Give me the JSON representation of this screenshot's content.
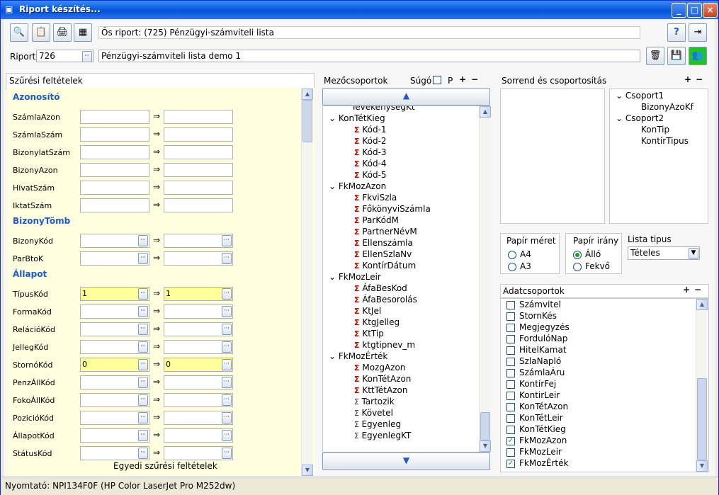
{
  "window": {
    "title": "Riport készítés...",
    "min": "_",
    "max": "□",
    "close": "×"
  },
  "toolbar": {
    "parent_label": "Ős riport:",
    "parent_value": "(725)  Pénzügyi-számviteli lista",
    "report_label": "Riport",
    "report_id": "726",
    "report_name": "Pénzügyi-számviteli lista demo 1"
  },
  "filter": {
    "title": "Szűrési feltételek",
    "footer": "Egyedi szűrési feltételek",
    "sections": [
      {
        "name": "Azonosító"
      },
      {
        "name": "BizonyTömb"
      },
      {
        "name": "Állapot"
      }
    ],
    "rows": [
      {
        "label": "SzámlaAzon",
        "from": "",
        "to": ""
      },
      {
        "label": "SzámlaSzám",
        "from": "",
        "to": ""
      },
      {
        "label": "BizonylatSzám",
        "from": "",
        "to": ""
      },
      {
        "label": "BizonyAzon",
        "from": "",
        "to": ""
      },
      {
        "label": "HivatSzám",
        "from": "",
        "to": ""
      },
      {
        "label": "IktatSzám",
        "from": "",
        "to": ""
      },
      {
        "label": "BizonyKód",
        "from": "",
        "to": ""
      },
      {
        "label": "ParBtoK",
        "from": "",
        "to": ""
      },
      {
        "label": "TípusKód",
        "from": "1",
        "to": "1"
      },
      {
        "label": "FormaKód",
        "from": "",
        "to": ""
      },
      {
        "label": "RelációKód",
        "from": "",
        "to": ""
      },
      {
        "label": "JellegKód",
        "from": "",
        "to": ""
      },
      {
        "label": "StornóKód",
        "from": "0",
        "to": "0"
      },
      {
        "label": "PenzÁllKód",
        "from": "",
        "to": ""
      },
      {
        "label": "FokoÁllKód",
        "from": "",
        "to": ""
      },
      {
        "label": "PozicióKód",
        "from": "",
        "to": ""
      },
      {
        "label": "ÁllapotKód",
        "from": "",
        "to": ""
      },
      {
        "label": "StátusKód",
        "from": "",
        "to": ""
      }
    ],
    "arrow": "⇒"
  },
  "fields": {
    "title": "Mezőcsoportok",
    "help": "Súgó",
    "p": "P",
    "plus": "+",
    "minus": "−",
    "partial": "TevékenységKt",
    "groups": [
      {
        "name": "KonTétKieg",
        "items": [
          "Kód-1",
          "Kód-2",
          "Kód-3",
          "Kód-4",
          "Kód-5"
        ]
      },
      {
        "name": "FkMozAzon",
        "items": [
          "FkviSzla",
          "FőkönyviSzámla",
          "ParKódM",
          "PartnerNévM",
          "Ellenszámla",
          "EllenSzlaNv",
          "KontírDátum"
        ]
      },
      {
        "name": "FkMozLeir",
        "items": [
          "ÁfaBesKod",
          "ÁfaBesorolás",
          "KtJel",
          "KtgJelleg",
          "KtTip",
          "ktgtipnev_m"
        ]
      },
      {
        "name": "FkMozÉrték",
        "items": [
          "MozgAzon",
          "KonTétAzon",
          "KttTétAzon",
          "Tartozik",
          "Követel",
          "Egyenleg",
          "EgyenlegKT"
        ]
      }
    ]
  },
  "sort": {
    "title": "Sorrend és csoportosítás",
    "groups": [
      {
        "name": "Csoport1",
        "items": [
          "BizonyAzoKf"
        ]
      },
      {
        "name": "Csoport2",
        "items": [
          "KonTip",
          "KontírTipus"
        ]
      }
    ]
  },
  "paper": {
    "size_title": "Papír méret",
    "sizes": [
      "A4",
      "A3"
    ],
    "dir_title": "Papír irány",
    "dirs": [
      "Álló",
      "Fekvő"
    ],
    "list_title": "Lista tipus",
    "list_value": "Tételes"
  },
  "datagroups": {
    "title": "Adatcsoportok",
    "items": [
      {
        "name": "Számvitel",
        "checked": false
      },
      {
        "name": "StornKés",
        "checked": false
      },
      {
        "name": "Megjegyzés",
        "checked": false
      },
      {
        "name": "FordulóNap",
        "checked": false
      },
      {
        "name": "HitelKamat",
        "checked": false
      },
      {
        "name": "SzlaNapló",
        "checked": false
      },
      {
        "name": "SzámlaÁru",
        "checked": false
      },
      {
        "name": "KontírFej",
        "checked": false
      },
      {
        "name": "KontirLeir",
        "checked": false
      },
      {
        "name": "KonTétAzon",
        "checked": false
      },
      {
        "name": "KonTétLeir",
        "checked": false
      },
      {
        "name": "KonTétKieg",
        "checked": false
      },
      {
        "name": "FkMozAzon",
        "checked": true
      },
      {
        "name": "FkMozLeir",
        "checked": false
      },
      {
        "name": "FkMozÉrték",
        "checked": true
      }
    ]
  },
  "status": {
    "printer": "Nyomtató: NPI134F0F (HP Color LaserJet Pro M252dw)"
  },
  "icons": [
    "preview-icon",
    "report-icon",
    "print-icon",
    "excel-icon",
    "help-icon",
    "exit-icon",
    "delete-icon",
    "save-icon",
    "users-icon"
  ]
}
